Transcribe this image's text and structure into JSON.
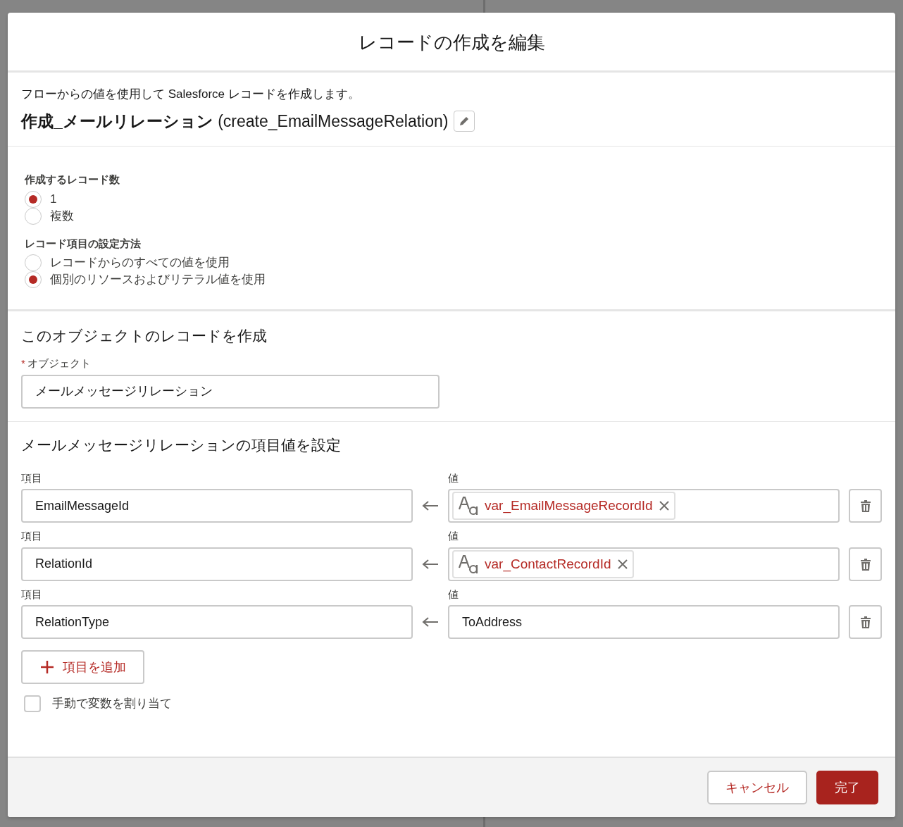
{
  "modal": {
    "title": "レコードの作成を編集"
  },
  "summary": {
    "description": "フローからの値を使用して Salesforce レコードを作成します。",
    "label": "作成_メールリレーション",
    "api_name": "(create_EmailMessageRelation)"
  },
  "radio_groups": [
    {
      "label": "作成するレコード数",
      "options": [
        {
          "label": "1",
          "selected": true
        },
        {
          "label": "複数",
          "selected": false
        }
      ]
    },
    {
      "label": "レコード項目の設定方法",
      "options": [
        {
          "label": "レコードからのすべての値を使用",
          "selected": false
        },
        {
          "label": "個別のリソースおよびリテラル値を使用",
          "selected": true
        }
      ]
    }
  ],
  "object_section": {
    "heading": "このオブジェクトのレコードを作成",
    "required_mark": "*",
    "field_label": "オブジェクト",
    "value": "メールメッセージリレーション"
  },
  "field_values": {
    "heading": "メールメッセージリレーションの項目値を設定",
    "rows": [
      {
        "field_label": "項目",
        "field": "EmailMessageId",
        "value_label": "値",
        "kind": "resource",
        "value": "var_EmailMessageRecordId"
      },
      {
        "field_label": "項目",
        "field": "RelationId",
        "value_label": "値",
        "kind": "resource",
        "value": "var_ContactRecordId"
      },
      {
        "field_label": "項目",
        "field": "RelationType",
        "value_label": "値",
        "kind": "text",
        "value": "ToAddress"
      }
    ],
    "add_button": "項目を追加",
    "manual_assign": {
      "label": "手動で変数を割り当て",
      "checked": false
    }
  },
  "footer": {
    "buttons": [
      {
        "label": "キャンセル",
        "kind": "neutral"
      },
      {
        "label": "完了",
        "kind": "brand"
      }
    ]
  }
}
